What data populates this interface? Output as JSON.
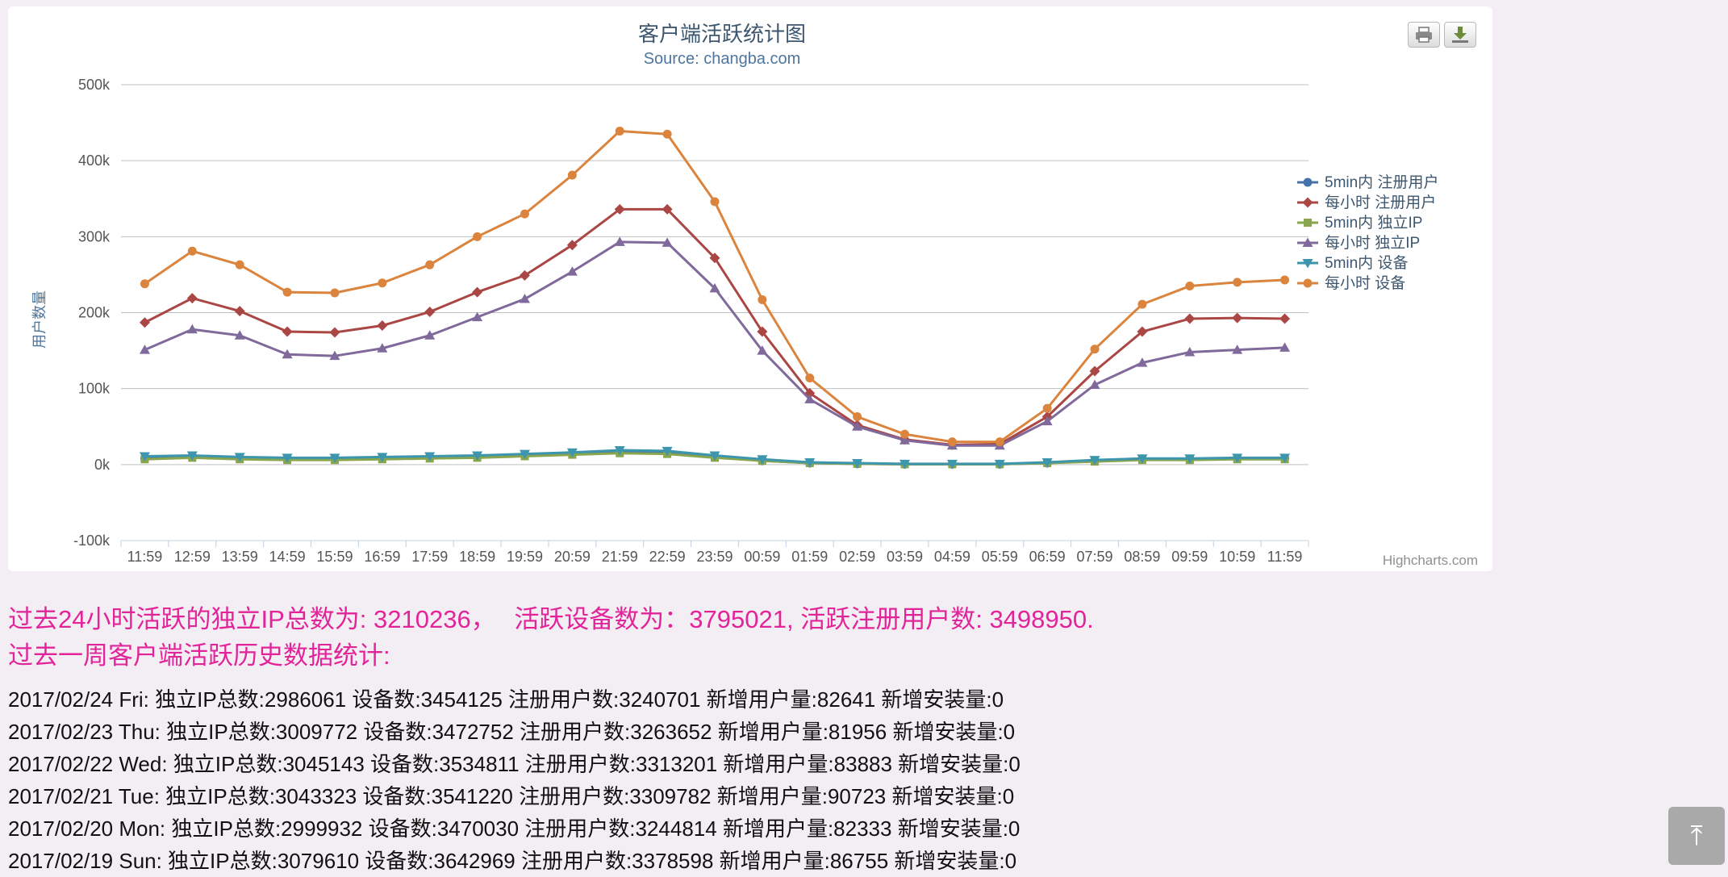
{
  "chart_data": {
    "type": "line",
    "title": "客户端活跃统计图",
    "subtitle": "Source: changba.com",
    "ylabel": "用户数量",
    "xlabel": "",
    "ylim": [
      -100000,
      500000
    ],
    "y_ticks": [
      -100000,
      0,
      100000,
      200000,
      300000,
      400000,
      500000
    ],
    "y_tick_labels": [
      "-100k",
      "0k",
      "100k",
      "200k",
      "300k",
      "400k",
      "500k"
    ],
    "grid": true,
    "legend_position": "right",
    "categories": [
      "11:59",
      "12:59",
      "13:59",
      "14:59",
      "15:59",
      "16:59",
      "17:59",
      "18:59",
      "19:59",
      "20:59",
      "21:59",
      "22:59",
      "23:59",
      "00:59",
      "01:59",
      "02:59",
      "03:59",
      "04:59",
      "05:59",
      "06:59",
      "07:59",
      "08:59",
      "09:59",
      "10:59",
      "11:59"
    ],
    "series": [
      {
        "name": "5min内 注册用户",
        "color": "#4572a7",
        "marker": "circle",
        "values": [
          8000,
          10000,
          8000,
          7000,
          7000,
          8000,
          9000,
          10000,
          12000,
          14000,
          17000,
          16000,
          10000,
          5000,
          2000,
          1000,
          500,
          500,
          500,
          2000,
          5000,
          7000,
          7000,
          8000,
          8000
        ]
      },
      {
        "name": "每小时 注册用户",
        "color": "#aa4643",
        "marker": "diamond",
        "values": [
          187000,
          219000,
          202000,
          175000,
          174000,
          183000,
          201000,
          227000,
          249000,
          289000,
          336000,
          336000,
          272000,
          175000,
          94000,
          52000,
          33000,
          26000,
          27000,
          63000,
          123000,
          175000,
          192000,
          193000,
          192000
        ]
      },
      {
        "name": "5min内 独立IP",
        "color": "#89a54e",
        "marker": "square",
        "values": [
          7000,
          9000,
          7000,
          6000,
          6000,
          7000,
          8000,
          9000,
          11000,
          13000,
          15000,
          14000,
          9000,
          5000,
          2000,
          1000,
          500,
          500,
          500,
          2000,
          4000,
          6000,
          6000,
          7000,
          7000
        ]
      },
      {
        "name": "每小时 独立IP",
        "color": "#80699b",
        "marker": "triangle",
        "values": [
          151000,
          178000,
          170000,
          145000,
          143000,
          153000,
          170000,
          194000,
          218000,
          254000,
          293000,
          292000,
          232000,
          150000,
          86000,
          50000,
          32000,
          25000,
          25000,
          57000,
          105000,
          134000,
          148000,
          151000,
          154000
        ]
      },
      {
        "name": "5min内 设备",
        "color": "#3d96ae",
        "marker": "triangle-down",
        "values": [
          11000,
          12000,
          10000,
          9000,
          9000,
          10000,
          11000,
          12000,
          14000,
          16000,
          19000,
          18000,
          12000,
          7000,
          3000,
          2000,
          1000,
          1000,
          1000,
          3000,
          6000,
          8000,
          8000,
          9000,
          9000
        ]
      },
      {
        "name": "每小时 设备",
        "color": "#db843d",
        "marker": "circle",
        "values": [
          238000,
          281000,
          263000,
          227000,
          226000,
          239000,
          263000,
          300000,
          330000,
          381000,
          439000,
          435000,
          346000,
          217000,
          114000,
          63000,
          40000,
          30000,
          30000,
          74000,
          152000,
          211000,
          235000,
          240000,
          243000
        ]
      }
    ]
  },
  "credits": "Highcharts.com",
  "export": {
    "print_icon": "printer-icon",
    "download_icon": "download-icon"
  },
  "summary": {
    "line1_part1": "过去24小时活跃的独立IP总数为: 3210236，",
    "line1_part2": "活跃设备数为：3795021, 活跃注册用户数: 3498950.",
    "line2": "过去一周客户端活跃历史数据统计:"
  },
  "history": [
    "2017/02/24 Fri: 独立IP总数:2986061 设备数:3454125 注册用户数:3240701 新增用户量:82641 新增安装量:0",
    "2017/02/23 Thu: 独立IP总数:3009772 设备数:3472752 注册用户数:3263652 新增用户量:81956 新增安装量:0",
    "2017/02/22 Wed: 独立IP总数:3045143 设备数:3534811 注册用户数:3313201 新增用户量:83883 新增安装量:0",
    "2017/02/21 Tue: 独立IP总数:3043323 设备数:3541220 注册用户数:3309782 新增用户量:90723 新增安装量:0",
    "2017/02/20 Mon: 独立IP总数:2999932 设备数:3470030 注册用户数:3244814 新增用户量:82333 新增安装量:0",
    "2017/02/19 Sun: 独立IP总数:3079610 设备数:3642969 注册用户数:3378598 新增用户量:86755 新增安装量:0"
  ],
  "back_to_top": {
    "icon": "arrow-up-icon",
    "glyph": "⤒"
  }
}
